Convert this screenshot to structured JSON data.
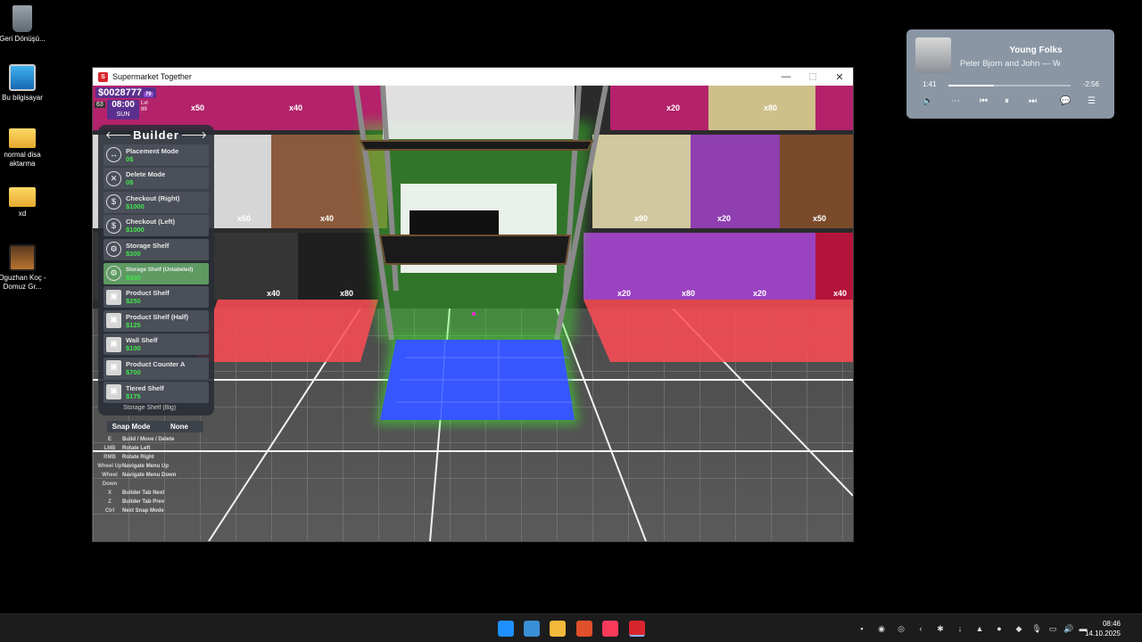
{
  "desktop": {
    "icons": [
      {
        "label": "Geri Dönüşü...",
        "kind": "recycle-bin"
      },
      {
        "label": "Bu bilgisayar",
        "kind": "computer"
      },
      {
        "label": "normal disa aktarma",
        "kind": "folder"
      },
      {
        "label": "xd",
        "kind": "folder"
      },
      {
        "label": "Oguzhan Koç - Domuz Gr...",
        "kind": "video"
      }
    ]
  },
  "window": {
    "title": "Supermarket Together",
    "app_icon": "S",
    "controls": {
      "minimize": "—",
      "maximize": "☐",
      "close": "✕"
    }
  },
  "hud": {
    "money": "$0028777",
    "money_badge": "79",
    "level_left": "63",
    "time": "08:00",
    "day": "SUN",
    "level_right_label": "Lvl",
    "level_right": "89"
  },
  "builder": {
    "title": "Builder",
    "prev": "🡐",
    "next": "🡒",
    "items": [
      {
        "name": "Placement Mode",
        "price": "0$",
        "icon": "↔"
      },
      {
        "name": "Delete Mode",
        "price": "0$",
        "icon": "✕"
      },
      {
        "name": "Checkout (Right)",
        "price": "$1000",
        "icon": "$"
      },
      {
        "name": "Checkout (Left)",
        "price": "$1000",
        "icon": "$"
      },
      {
        "name": "Storage Shelf",
        "price": "$300",
        "icon": "⚙"
      },
      {
        "name": "Storage Shelf (Unlabeled)",
        "price": "$300",
        "icon": "⚙"
      },
      {
        "name": "Product Shelf",
        "price": "$250",
        "icon": "▣"
      },
      {
        "name": "Product Shelf (Half)",
        "price": "$125",
        "icon": "▣"
      },
      {
        "name": "Wall Shelf",
        "price": "$100",
        "icon": "▣"
      },
      {
        "name": "Product Counter A",
        "price": "$700",
        "icon": "▣"
      },
      {
        "name": "Tiered Shelf",
        "price": "$175",
        "icon": "▣"
      }
    ],
    "cut_item": "Storage Shelf (Big)",
    "selected_index": 5
  },
  "snap": {
    "label": "Snap Mode",
    "value": "None"
  },
  "keybinds": [
    {
      "key": "E",
      "action": "Build / Move / Delete"
    },
    {
      "key": "LMB",
      "action": "Rotate Left"
    },
    {
      "key": "RMB",
      "action": "Rotate Right"
    },
    {
      "key": "Wheel Up",
      "action": "Navigate Menu Up"
    },
    {
      "key": "Wheel Down",
      "action": "Navigate Menu Down"
    },
    {
      "key": "X",
      "action": "Builder Tab Next"
    },
    {
      "key": "Z",
      "action": "Builder Tab Prev"
    },
    {
      "key": "Ctrl",
      "action": "Next Snap Mode"
    }
  ],
  "scene_labels": [
    "x50",
    "x40",
    "x20",
    "x80",
    "x60",
    "x40",
    "x90",
    "x20",
    "x50",
    "x40",
    "x80",
    "x20",
    "x80",
    "x20",
    "x40"
  ],
  "media": {
    "song": "Young Folks",
    "artist": "Peter Bjorn and John — Writer's Block",
    "elapsed": "1:41",
    "remaining": "-2:56",
    "progress": 0.37
  },
  "taskbar": {
    "time": "08:46",
    "date": "14.10.2025"
  },
  "colors": {
    "hud_purple": "#5b2f8e",
    "price_green": "#41e64c",
    "selected_item": "#5e9a62",
    "floor_red": "#ff4b55",
    "preview_blue": "#3656ff",
    "glow_green": "#3cff2a"
  }
}
